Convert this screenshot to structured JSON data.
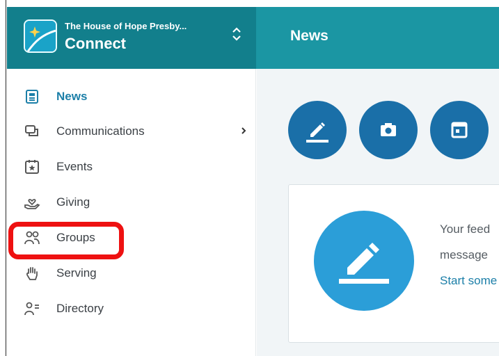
{
  "header": {
    "org_name": "The House of Hope Presby...",
    "app_name": "Connect",
    "page_title": "News"
  },
  "sidebar": {
    "items": [
      {
        "label": "News",
        "icon": "news-icon",
        "active": true
      },
      {
        "label": "Communications",
        "icon": "chat-icon",
        "has_submenu": true
      },
      {
        "label": "Events",
        "icon": "calendar-star-icon"
      },
      {
        "label": "Giving",
        "icon": "hand-heart-icon"
      },
      {
        "label": "Groups",
        "icon": "people-icon"
      },
      {
        "label": "Serving",
        "icon": "raised-hand-icon"
      },
      {
        "label": "Directory",
        "icon": "person-list-icon"
      }
    ]
  },
  "main": {
    "actions": [
      {
        "icon": "pencil-icon"
      },
      {
        "icon": "camera-icon"
      },
      {
        "icon": "calendar-icon"
      }
    ],
    "feed": {
      "line1": "Your feed",
      "line2": "message",
      "link": "Start some"
    }
  },
  "colors": {
    "header_dark": "#127f8c",
    "header_light": "#1b96a3",
    "action_blue": "#1a6fa8",
    "feed_circle": "#2b9ed8",
    "active_text": "#1c7fa8",
    "annotation_red": "#ee1111"
  }
}
